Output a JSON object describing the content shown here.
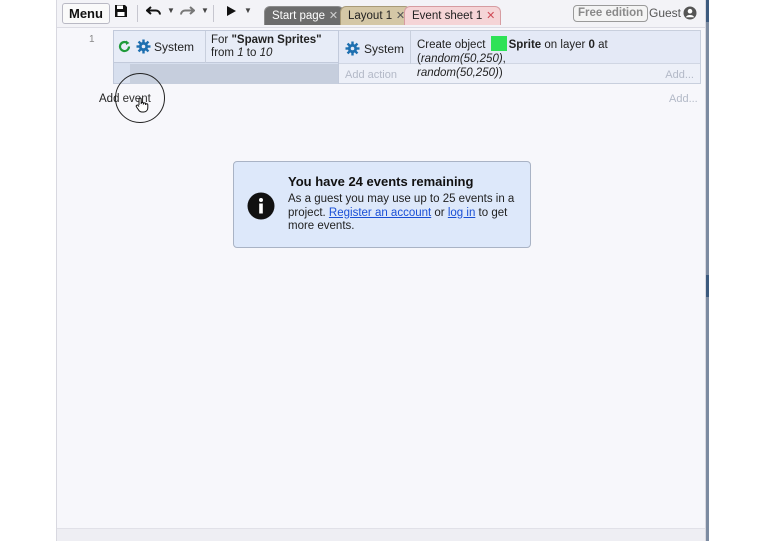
{
  "toolbar": {
    "menu_label": "Menu",
    "tabs": [
      {
        "label": "Start page"
      },
      {
        "label": "Layout 1"
      },
      {
        "label": "Event sheet 1"
      }
    ],
    "edition_badge": "Free edition",
    "user_label": "Guest"
  },
  "event_sheet": {
    "events": [
      {
        "number": "1",
        "condition": {
          "object": "System",
          "text_prefix": "For ",
          "loop_name": "\"Spawn Sprites\"",
          "text_from": "from ",
          "start": "1",
          "text_to": " to ",
          "end": "10"
        },
        "action": {
          "object": "System",
          "text_prefix": "Create object ",
          "object_name": "Sprite",
          "text_layer": " on layer ",
          "layer": "0",
          "text_at": " at (",
          "x_expr": "random(50,250)",
          "comma": ",",
          "y_expr": "random(50,250)",
          "close": ")",
          "sprite_color": "#2ee257"
        },
        "add_action_label": "Add action",
        "add_more_label": "Add..."
      }
    ],
    "add_event_label": "Add event",
    "add_more_label": "Add..."
  },
  "info_panel": {
    "title": "You have 24 events remaining",
    "body_prefix": "As a guest you may use up to 25 events in a project. ",
    "register_link": "Register an account",
    "or_text": " or ",
    "login_link": "log in",
    "body_suffix": " to get more events."
  },
  "colors": {
    "accent_link": "#1a4fd6",
    "condition_bg": "#e7ecf7",
    "info_bg": "#dde8fa"
  }
}
